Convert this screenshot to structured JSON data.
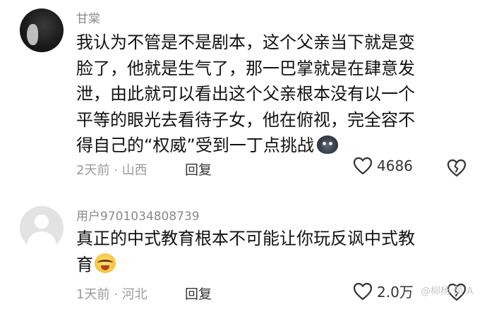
{
  "comments": [
    {
      "username": "甘棠",
      "text_lines": [
        "我认为不管是不是剧本，这个父亲当下就是变",
        "脸了，他就是生气了，那一巴掌就是在肆意发",
        "泄，由此就可以看出这个父亲根本没有以一个",
        "平等的眼光去看待子女，他在俯视，完全容不",
        "得自己的“权威”受到一丁点挑战"
      ],
      "emoji": "dark-face-emoji",
      "meta": "2天前 · 山西",
      "reply_label": "回复",
      "like_count": "4686"
    },
    {
      "username": "用户9701034808739",
      "text_lines": [
        "真正的中式教育根本不可能让你玩反讽中式教",
        "育"
      ],
      "emoji": "crying-laughing-emoji",
      "meta": "1天前 · 河北",
      "reply_label": "回复",
      "like_count": "2.0万"
    }
  ],
  "watermark": "@柳杨 简 A",
  "icons": {
    "like": "heart-outline-icon",
    "dislike": "broken-heart-icon"
  },
  "colors": {
    "text": "#111111",
    "meta": "#9a9a9a",
    "background": "#ffffff"
  }
}
